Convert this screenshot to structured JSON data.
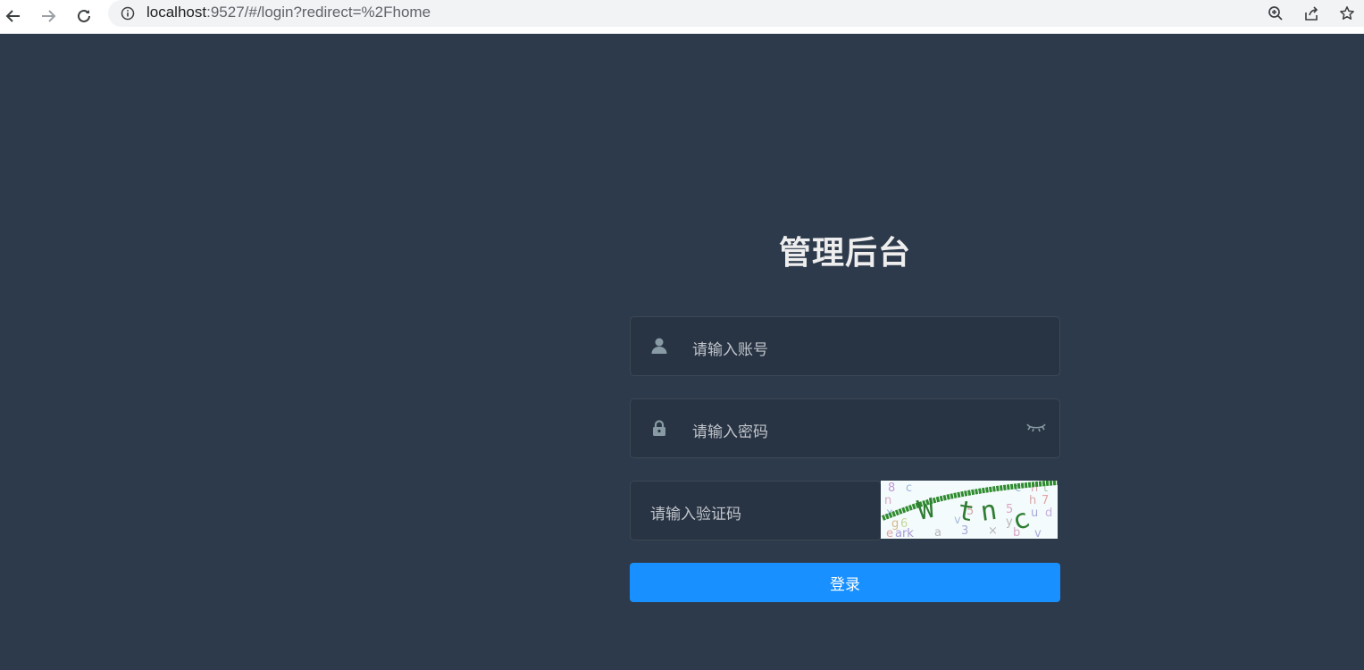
{
  "browser": {
    "url_host": "localhost",
    "url_path": ":9527/#/login?redirect=%2Fhome"
  },
  "login": {
    "title": "管理后台",
    "username_placeholder": "请输入账号",
    "password_placeholder": "请输入密码",
    "captcha_placeholder": "请输入验证码",
    "captcha_text": "Wtnc",
    "submit_label": "登录"
  },
  "colors": {
    "page_background": "#2d3a4b",
    "input_background": "#283443",
    "primary_button": "#1890ff",
    "icon": "#889aa4"
  },
  "icons": {
    "back": "arrow-left-icon",
    "forward": "arrow-right-icon",
    "reload": "reload-icon",
    "site_info": "info-icon",
    "zoom": "zoom-icon",
    "share": "share-icon",
    "bookmark": "star-icon",
    "username": "user-icon",
    "password": "lock-icon",
    "show_password": "eye-closed-icon"
  }
}
